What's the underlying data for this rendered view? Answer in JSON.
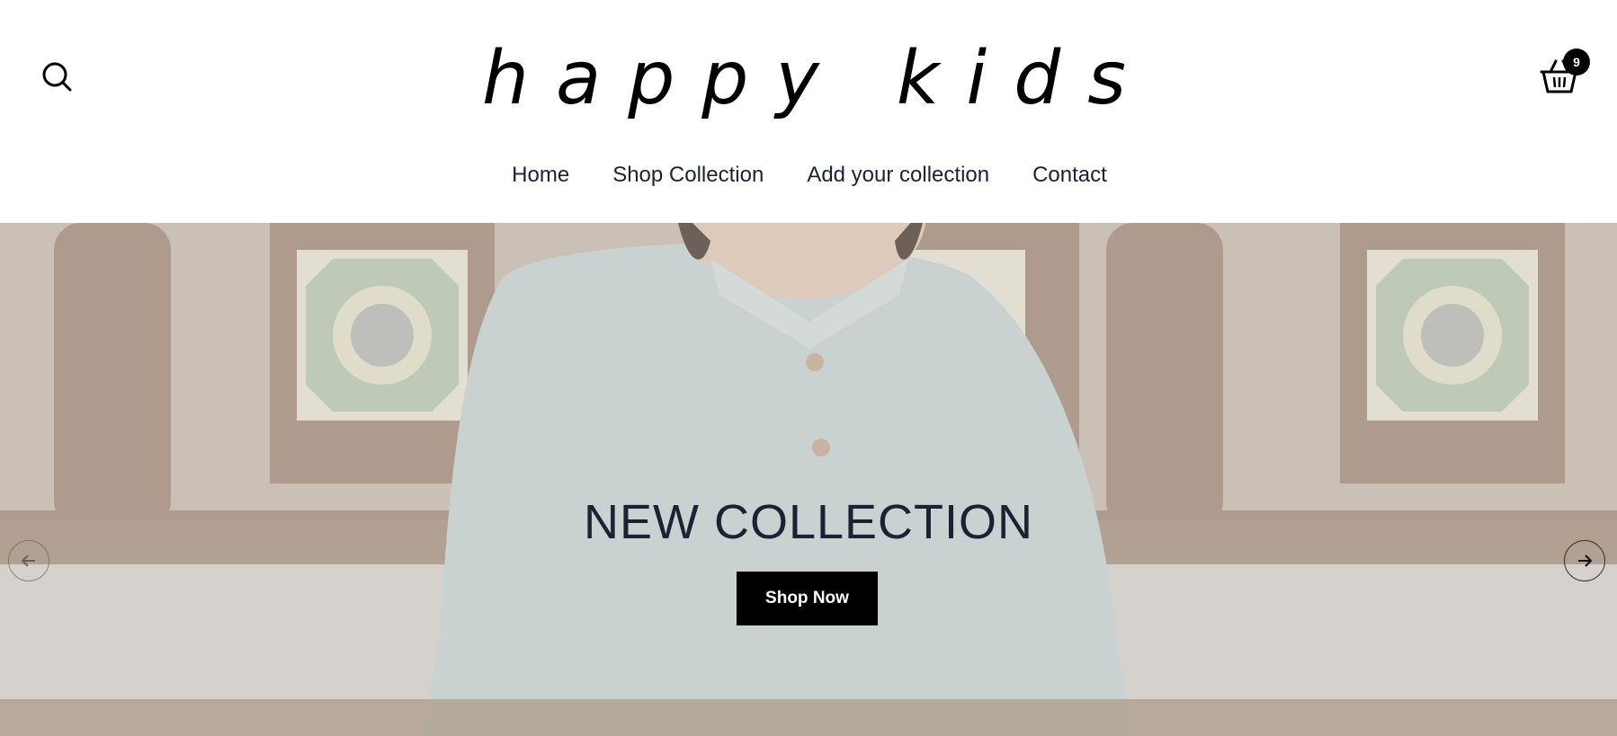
{
  "header": {
    "logo_text": "happy kids",
    "cart_count": "9",
    "search_icon": "search-icon",
    "cart_icon": "basket-icon"
  },
  "nav": {
    "items": [
      {
        "label": "Home"
      },
      {
        "label": "Shop Collection"
      },
      {
        "label": "Add your collection"
      },
      {
        "label": "Contact"
      }
    ]
  },
  "hero": {
    "title": "NEW COLLECTION",
    "button_label": "Shop Now",
    "prev_icon": "arrow-left-icon",
    "next_icon": "arrow-right-icon"
  },
  "colors": {
    "text_dark": "#1b2233",
    "button_bg": "#000000",
    "button_text": "#ffffff"
  }
}
